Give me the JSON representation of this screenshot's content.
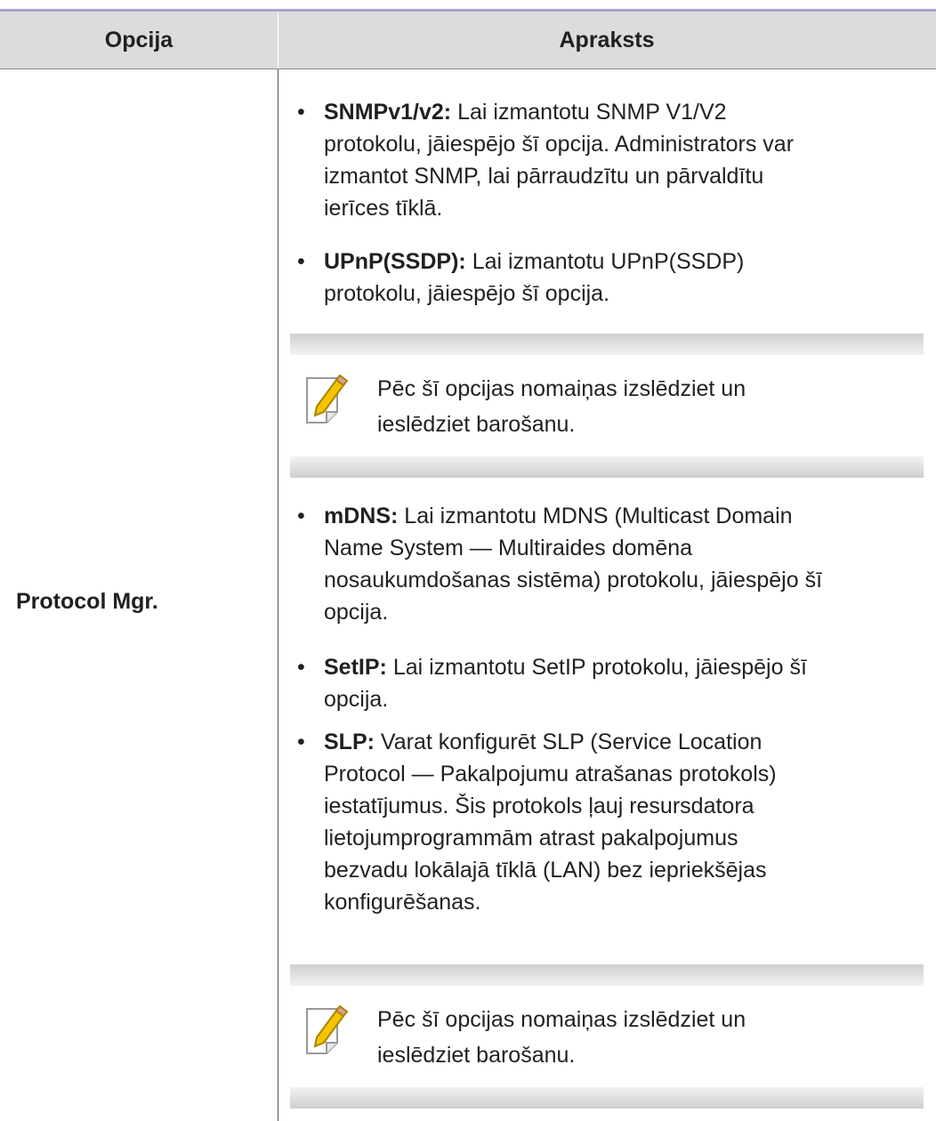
{
  "table": {
    "header": {
      "option": "Opcija",
      "description": "Apraksts"
    },
    "option_label": "Protocol Mgr.",
    "items_group1": [
      {
        "term": "SNMPv1/v2:",
        "lines": [
          "Lai izmantotu SNMP V1/V2",
          "protokolu, jāiespējo šī opcija. Administrators var",
          "izmantot SNMP, lai pārraudzītu un pārvaldītu",
          "ierīces tīklā."
        ]
      },
      {
        "term": "UPnP(SSDP):",
        "lines": [
          "Lai izmantotu UPnP(SSDP)",
          "protokolu, jāiespējo šī opcija."
        ]
      }
    ],
    "note1": {
      "lines": [
        "Pēc šī opcijas nomaiņas izslēdziet un",
        "ieslēdziet barošanu."
      ]
    },
    "items_group2": [
      {
        "term": "mDNS:",
        "lines": [
          "Lai izmantotu MDNS (Multicast Domain",
          "Name System — Multiraides domēna",
          "nosaukumdošanas sistēma) protokolu, jāiespējo šī",
          "opcija."
        ]
      },
      {
        "term": "SetIP:",
        "lines": [
          "Lai izmantotu SetIP protokolu, jāiespējo šī",
          "opcija."
        ]
      },
      {
        "term": "SLP:",
        "lines": [
          "Varat konfigurēt SLP (Service Location",
          "Protocol — Pakalpojumu atrašanas protokols)",
          "iestatījumus. Šis protokols ļauj resursdatora",
          "lietojumprogrammām atrast pakalpojumus",
          "bezvadu lokālajā tīklā (LAN) bez iepriekšējas",
          "konfigurēšanas."
        ]
      }
    ],
    "note2": {
      "lines": [
        "Pēc šī opcijas nomaiņas izslēdziet un",
        "ieslēdziet barošanu."
      ]
    },
    "bullet_symbol": "•",
    "note_icon": "note-pencil-icon"
  }
}
